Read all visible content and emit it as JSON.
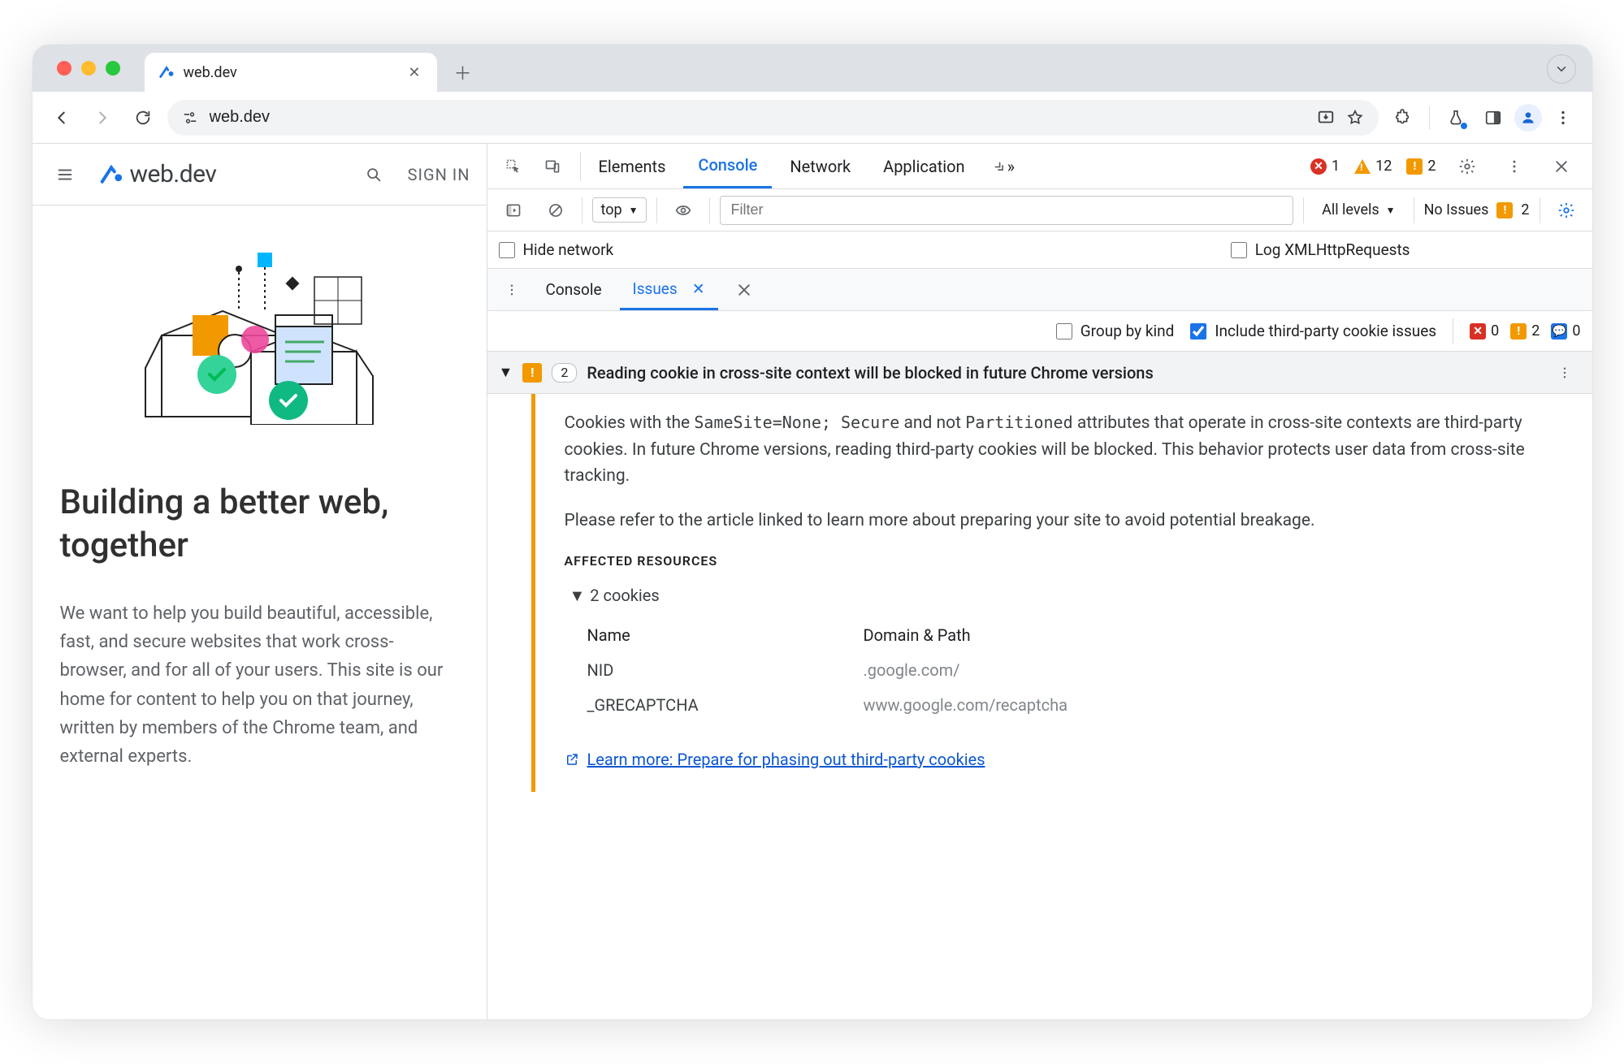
{
  "browser": {
    "tab_title": "web.dev",
    "url": "web.dev"
  },
  "page": {
    "site_name": "web.dev",
    "sign_in": "SIGN IN",
    "headline": "Building a better web, together",
    "paragraph": "We want to help you build beautiful, accessible, fast, and secure websites that work cross-browser, and for all of your users. This site is our home for content to help you on that journey, written by members of the Chrome team, and external experts."
  },
  "devtools": {
    "tabs": [
      "Elements",
      "Console",
      "Network",
      "Application"
    ],
    "active_tab": "Console",
    "errors_count": 1,
    "warnings_count": 12,
    "issues_count": 2,
    "console_toolbar": {
      "context": "top",
      "filter_placeholder": "Filter",
      "levels": "All levels",
      "no_issues": "No Issues",
      "no_issues_count": 2
    },
    "options": {
      "hide_network": "Hide network",
      "log_xhr": "Log XMLHttpRequests"
    },
    "drawer_tabs": [
      "Console",
      "Issues"
    ],
    "drawer_active": "Issues",
    "issues_panel": {
      "group_by_kind": "Group by kind",
      "include_third_party": "Include third-party cookie issues",
      "counts": {
        "error": 0,
        "warning": 2,
        "info": 0
      }
    },
    "issue": {
      "count": 2,
      "title": "Reading cookie in cross-site context will be blocked in future Chrome versions",
      "desc_pre1": "Cookies with the ",
      "code1": "SameSite=None; Secure",
      "desc_mid1": " and not ",
      "code2": "Partitioned",
      "desc_post1": " attributes that operate in cross-site contexts are third-party cookies. In future Chrome versions, reading third-party cookies will be blocked. This behavior protects user data from cross-site tracking.",
      "desc2": "Please refer to the article linked to learn more about preparing your site to avoid potential breakage.",
      "affected_heading": "AFFECTED RESOURCES",
      "cookies_summary": "2 cookies",
      "table": {
        "headers": [
          "Name",
          "Domain & Path"
        ],
        "rows": [
          {
            "name": "NID",
            "domain": ".google.com/"
          },
          {
            "name": "_GRECAPTCHA",
            "domain": "www.google.com/recaptcha"
          }
        ]
      },
      "learn_more": "Learn more: Prepare for phasing out third-party cookies"
    }
  }
}
